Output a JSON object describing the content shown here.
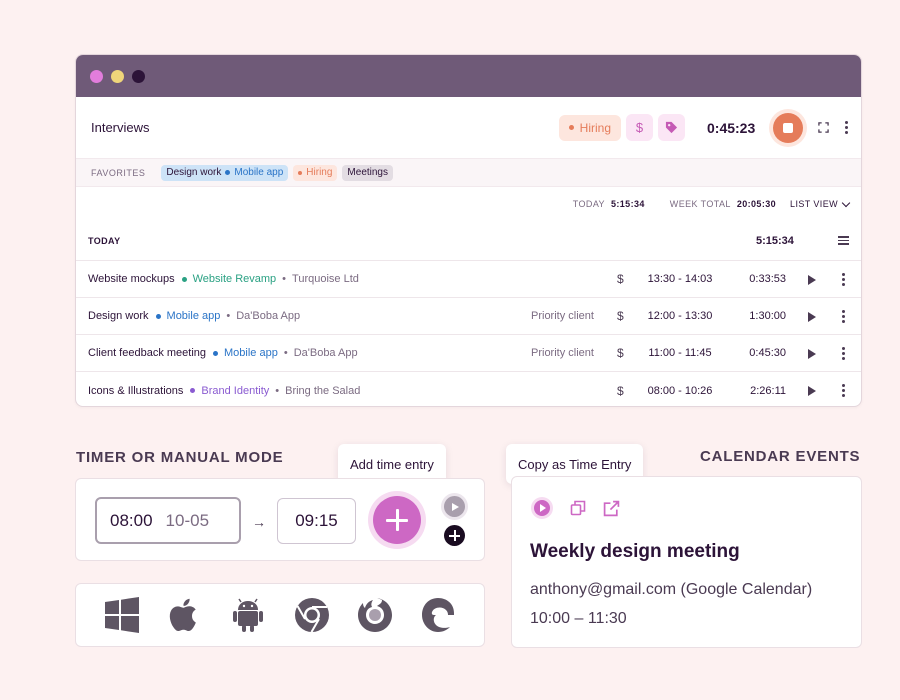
{
  "timer": {
    "description": "Interviews",
    "tag_label": "Hiring",
    "billable_symbol": "$",
    "elapsed": "0:45:23"
  },
  "favorites": {
    "label": "FAVORITES",
    "items": [
      {
        "description": "Design work",
        "project": "Mobile app"
      },
      {
        "label": "Hiring"
      },
      {
        "label": "Meetings"
      }
    ]
  },
  "totals": {
    "today_label": "TODAY",
    "today_value": "5:15:34",
    "week_label": "WEEK TOTAL",
    "week_value": "20:05:30",
    "view_label": "LIST VIEW"
  },
  "day": {
    "label": "TODAY",
    "total": "5:15:34"
  },
  "entries": [
    {
      "description": "Website mockups",
      "project": "Website Revamp",
      "project_color": "#2aa183",
      "client": "Turquoise Ltd",
      "tag": "",
      "billable": "$",
      "range": "13:30 - 14:03",
      "duration": "0:33:53"
    },
    {
      "description": "Design work",
      "project": "Mobile app",
      "project_color": "#2a74c7",
      "client": "Da'Boba App",
      "tag": "Priority client",
      "billable": "$",
      "range": "12:00 - 13:30",
      "duration": "1:30:00"
    },
    {
      "description": "Client feedback meeting",
      "project": "Mobile app",
      "project_color": "#2a74c7",
      "client": "Da'Boba App",
      "tag": "Priority client",
      "billable": "$",
      "range": "11:00 - 11:45",
      "duration": "0:45:30"
    },
    {
      "description": "Icons & Illustrations",
      "project": "Brand Identity",
      "project_color": "#8a5bd1",
      "client": "Bring the Salad",
      "tag": "",
      "billable": "$",
      "range": "08:00 - 10:26",
      "duration": "2:26:11"
    }
  ],
  "separator": "•",
  "manual_mode": {
    "title": "TIMER OR MANUAL MODE",
    "tooltip": "Add time entry",
    "start_time": "08:00",
    "start_date": "10-05",
    "arrow": "→",
    "end_time": "09:15"
  },
  "calendar": {
    "title": "CALENDAR EVENTS",
    "tooltip": "Copy as Time Entry",
    "event_title": "Weekly design meeting",
    "event_source": "anthony@gmail.com (Google Calendar)",
    "event_time": "10:00 – 11:30"
  },
  "platforms": [
    "windows-icon",
    "apple-icon",
    "android-icon",
    "chrome-icon",
    "firefox-icon",
    "edge-icon"
  ]
}
